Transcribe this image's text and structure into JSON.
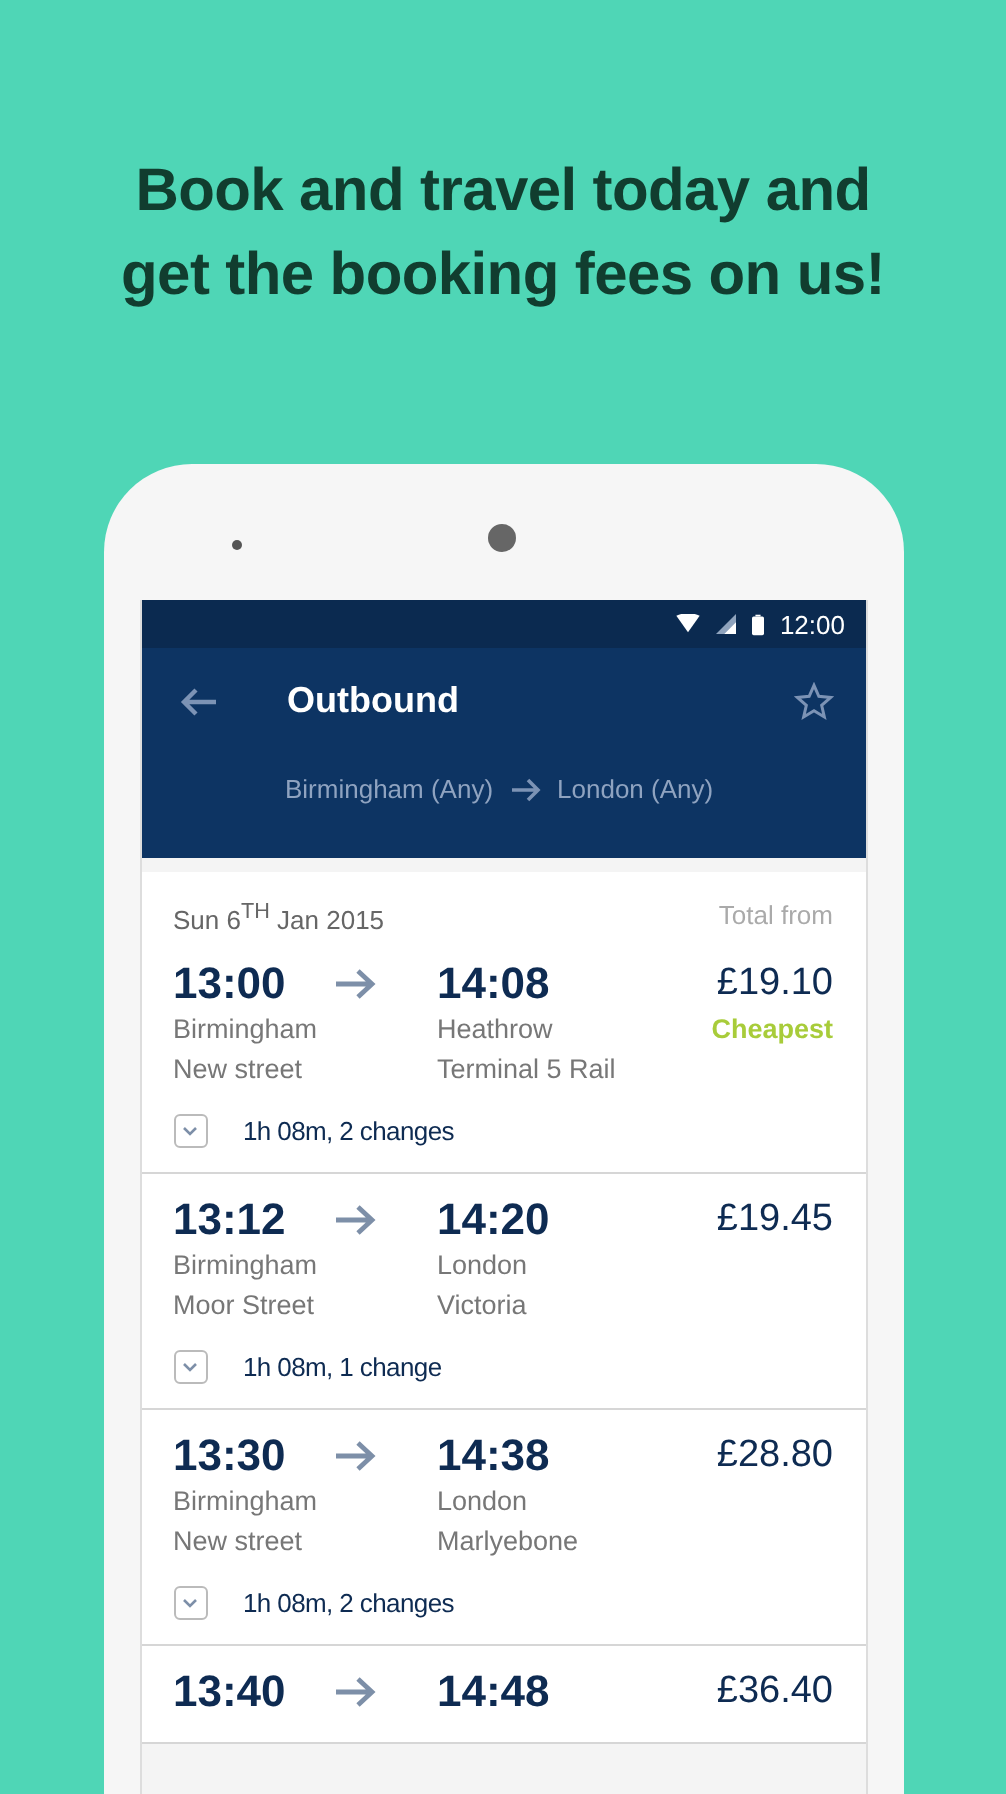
{
  "headline": [
    "Book and travel today and",
    "get the booking fees on us!"
  ],
  "status_bar": {
    "time": "12:00"
  },
  "app_bar": {
    "title": "Outbound",
    "origin": "Birmingham (Any)",
    "destination": "London (Any)"
  },
  "list_header": {
    "date": "Sun 6$^{TH}$ Jan 2015",
    "price_label": "Total from"
  },
  "journeys": [
    {
      "depart": "13:00",
      "arrive": "14:08",
      "from": [
        "Birmingham",
        "New street"
      ],
      "to": [
        "Heathrow",
        "Terminal 5 Rail"
      ],
      "price": "£19.10",
      "tag": "Cheapest",
      "summary": "1h 08m, 2 changes"
    },
    {
      "depart": "13:12",
      "arrive": "14:20",
      "from": [
        "Birmingham",
        "Moor Street"
      ],
      "to": [
        "London",
        "Victoria"
      ],
      "price": "£19.45",
      "summary": "1h 08m, 1 change"
    },
    {
      "depart": "13:30",
      "arrive": "14:38",
      "from": [
        "Birmingham",
        "New street"
      ],
      "to": [
        "London",
        "Marlyebone"
      ],
      "price": "£28.80",
      "summary": "1h 08m, 2 changes"
    },
    {
      "depart": "13:40",
      "arrive": "14:48",
      "price": "£36.40"
    }
  ]
}
